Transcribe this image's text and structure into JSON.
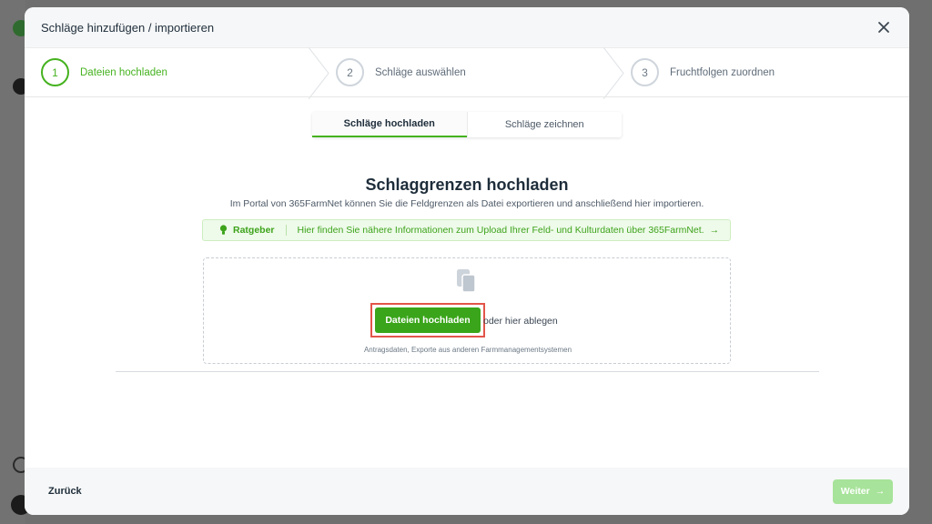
{
  "modal": {
    "title": "Schläge hinzufügen / importieren"
  },
  "steps": [
    {
      "number": "1",
      "label": "Dateien hochladen"
    },
    {
      "number": "2",
      "label": "Schläge auswählen"
    },
    {
      "number": "3",
      "label": "Fruchtfolgen zuordnen"
    }
  ],
  "tabs": [
    {
      "label": "Schläge hochladen"
    },
    {
      "label": "Schläge zeichnen"
    }
  ],
  "content": {
    "heading": "Schlaggrenzen hochladen",
    "subheading": "Im Portal von 365FarmNet können Sie die Feldgrenzen als Datei exportieren und anschließend hier importieren."
  },
  "advice": {
    "title": "Ratgeber",
    "text": "Hier finden Sie nähere Informationen zum Upload Ihrer Feld- und Kulturdaten über 365FarmNet.",
    "arrow": "→"
  },
  "dropzone": {
    "button_label": "Dateien hochladen",
    "drop_text": "oder hier ablegen",
    "hint": "Antragsdaten, Exporte aus anderen Farmmanagementsystemen"
  },
  "footer": {
    "back_label": "Zurück",
    "next_label": "Weiter",
    "next_arrow": "→"
  },
  "colors": {
    "accent": "#45b21f",
    "button_green": "#3aa51a",
    "disabled_green": "#a7e39a",
    "highlight_red": "#e2554a"
  },
  "icons": [
    "close-icon",
    "bulb-icon",
    "files-icon",
    "arrow-right-icon",
    "chevron-step-icon"
  ]
}
